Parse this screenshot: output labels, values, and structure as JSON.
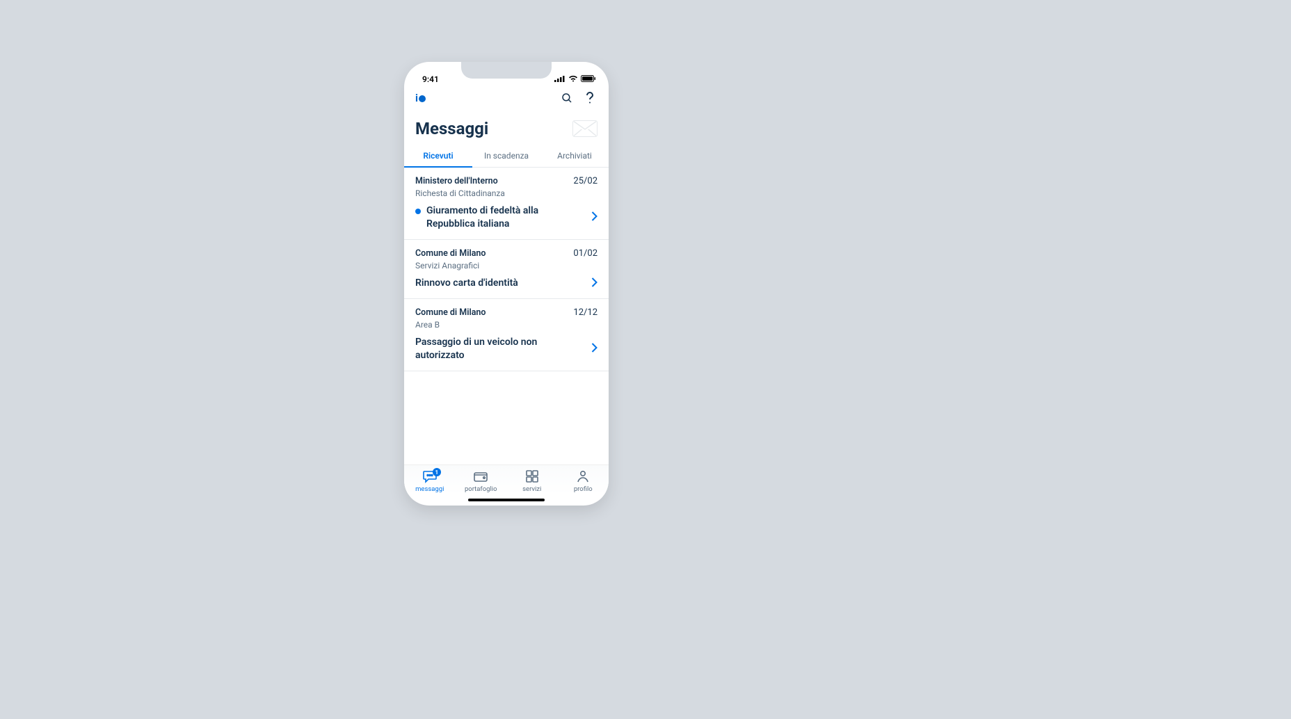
{
  "status": {
    "time": "9:41"
  },
  "header": {
    "title": "Messaggi"
  },
  "tabs": [
    {
      "label": "Ricevuti",
      "active": true
    },
    {
      "label": "In scadenza",
      "active": false
    },
    {
      "label": "Archiviati",
      "active": false
    }
  ],
  "messages": [
    {
      "sender": "Ministero dell'Interno",
      "date": "25/02",
      "service": "Richesta di Cittadinanza",
      "title": "Giuramento di fedeltà alla Repubblica italiana",
      "unread": true
    },
    {
      "sender": "Comune di Milano",
      "date": "01/02",
      "service": "Servizi Anagrafici",
      "title": "Rinnovo carta d'identità",
      "unread": false
    },
    {
      "sender": "Comune di Milano",
      "date": "12/12",
      "service": "Area B",
      "title": "Passaggio di un veicolo non autorizzato",
      "unread": false
    }
  ],
  "tabbar": {
    "items": [
      {
        "label": "messaggi",
        "badge": "1",
        "active": true
      },
      {
        "label": "portafoglio",
        "active": false
      },
      {
        "label": "servizi",
        "active": false
      },
      {
        "label": "profilo",
        "active": false
      }
    ]
  }
}
